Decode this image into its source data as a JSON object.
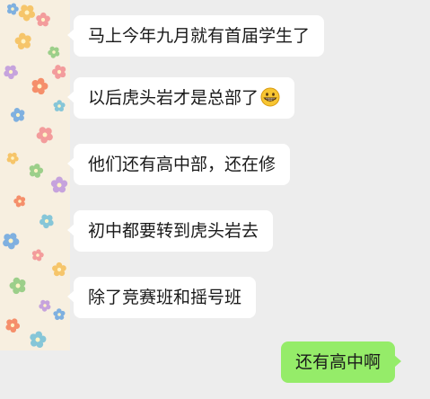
{
  "messages": [
    {
      "side": "left",
      "text": "马上今年九月就有首届学生了"
    },
    {
      "side": "left",
      "text": "以后虎头岩才是总部了",
      "emoji": "grin-emoji"
    },
    {
      "side": "left",
      "text": "他们还有高中部，还在修"
    },
    {
      "side": "left",
      "text": "初中都要转到虎头岩去"
    },
    {
      "side": "left",
      "text": "除了竞赛班和摇号班"
    },
    {
      "side": "right",
      "text": "还有高中啊"
    }
  ],
  "colors": {
    "background": "#ededed",
    "incoming_bubble": "#ffffff",
    "outgoing_bubble": "#95ec69"
  },
  "icons": {
    "avatar": "floral-pattern-avatar",
    "emoji": "grin-emoji"
  }
}
